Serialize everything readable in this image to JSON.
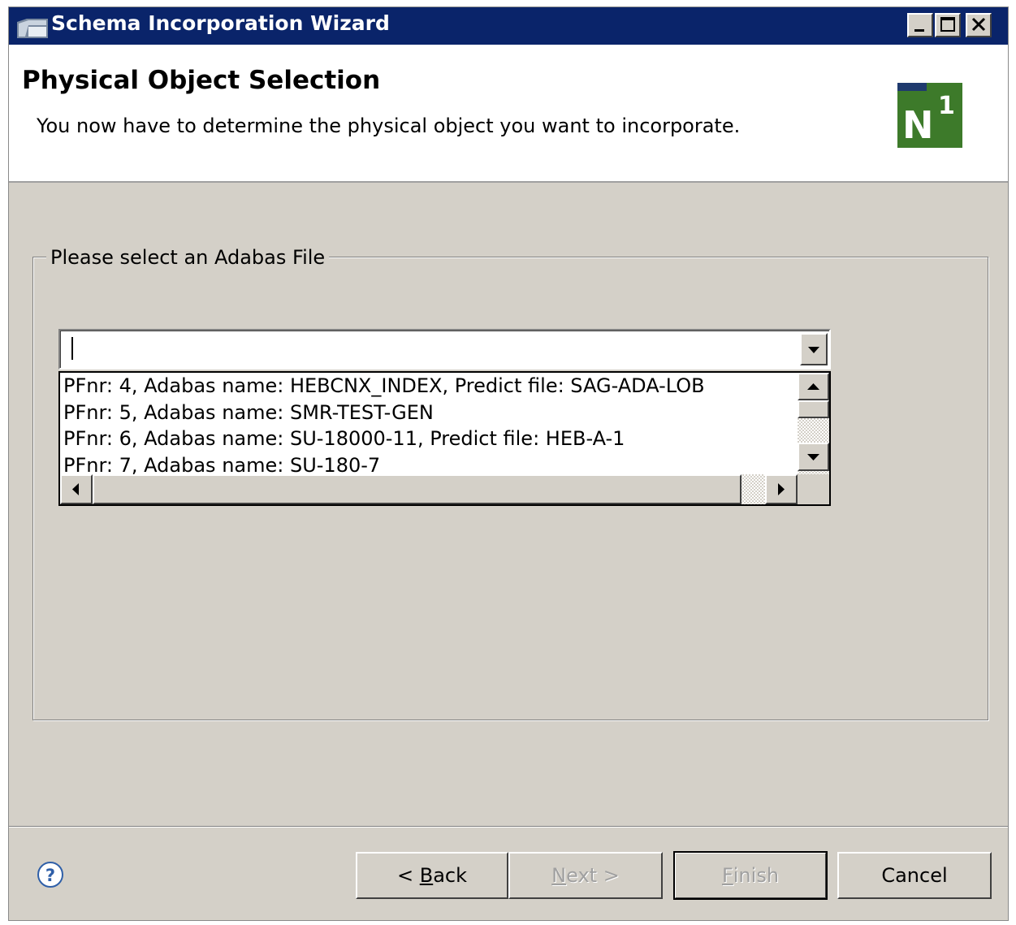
{
  "window": {
    "title": "Schema Incorporation Wizard",
    "colors": {
      "titlebar": "#0a246a",
      "face": "#d4d0c8",
      "logo": "#3d7a2a"
    }
  },
  "header": {
    "title": "Physical Object Selection",
    "description": "You now have to determine the physical object you want to incorporate.",
    "logo_icon": "n1-logo-icon"
  },
  "group": {
    "label": "Please select an Adabas File",
    "combo": {
      "value": ""
    },
    "list_items": [
      "PFnr: 4, Adabas name: HEBCNX_INDEX, Predict file: SAG-ADA-LOB",
      "PFnr: 5, Adabas name: SMR-TEST-GEN",
      "PFnr: 6, Adabas name: SU-18000-11, Predict file: HEB-A-1",
      "PFnr: 7, Adabas name: SU-180-7"
    ]
  },
  "footer": {
    "help_icon": "help-icon",
    "buttons": {
      "back": {
        "before": "< ",
        "mnemonic": "B",
        "after": "ack"
      },
      "next": {
        "before": "",
        "mnemonic": "N",
        "after": "ext >"
      },
      "finish": {
        "before": "",
        "mnemonic": "F",
        "after": "inish"
      },
      "cancel": {
        "label": "Cancel"
      }
    }
  }
}
